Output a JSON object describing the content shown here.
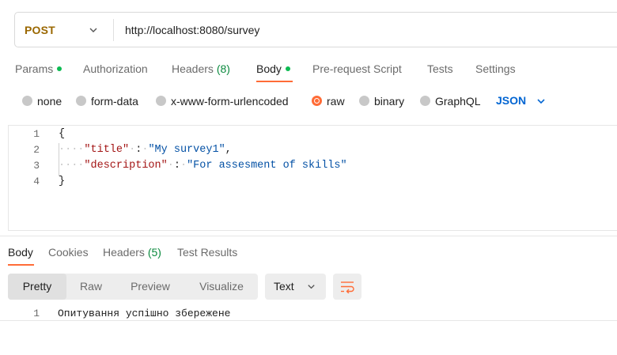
{
  "request": {
    "method": "POST",
    "url": "http://localhost:8080/survey"
  },
  "request_tabs": [
    {
      "label": "Params",
      "dot": true
    },
    {
      "label": "Authorization"
    },
    {
      "label": "Headers",
      "count": "(8)"
    },
    {
      "label": "Body",
      "dot": true,
      "active": true
    },
    {
      "label": "Pre-request Script"
    },
    {
      "label": "Tests"
    },
    {
      "label": "Settings"
    }
  ],
  "body_types": [
    {
      "label": "none"
    },
    {
      "label": "form-data"
    },
    {
      "label": "x-www-form-urlencoded"
    },
    {
      "label": "raw",
      "selected": true
    },
    {
      "label": "binary"
    },
    {
      "label": "GraphQL"
    }
  ],
  "format": "JSON",
  "editor": {
    "line_numbers": [
      "1",
      "2",
      "3",
      "4"
    ],
    "open_brace": "{",
    "close_brace": "}",
    "fields": [
      {
        "key": "\"title\"",
        "value": "\"My survey1\""
      },
      {
        "key": "\"description\"",
        "value": "\"For assesment of skills\""
      }
    ]
  },
  "response_tabs": [
    {
      "label": "Body",
      "active": true
    },
    {
      "label": "Cookies"
    },
    {
      "label": "Headers",
      "count": "(5)"
    },
    {
      "label": "Test Results"
    }
  ],
  "view_modes": [
    "Pretty",
    "Raw",
    "Preview",
    "Visualize"
  ],
  "active_view": "Pretty",
  "response_format": "Text",
  "response": {
    "line_number": "1",
    "text": "Опитування успішно збережене"
  },
  "colors": {
    "accent": "#ff6c37",
    "method": "#9a6700",
    "dot": "#0cbb52",
    "json": "#0265d2",
    "json_key": "#a31515",
    "json_string": "#0451a5"
  },
  "icons": [
    "chevron-down-icon",
    "wrap-lines-icon"
  ]
}
